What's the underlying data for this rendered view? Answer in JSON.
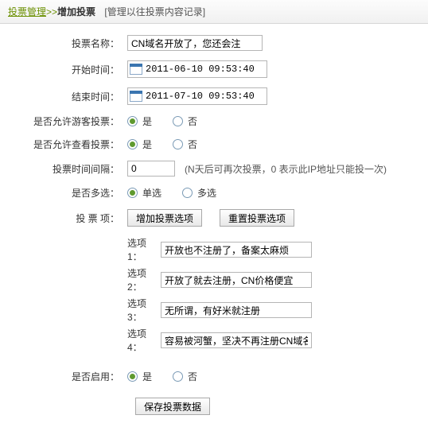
{
  "breadcrumb": {
    "root": "投票管理",
    "sep": ">>",
    "current": "增加投票",
    "note": "[管理以往投票内容记录]"
  },
  "labels": {
    "name": "投票名称：",
    "start": "开始时间：",
    "end": "结束时间：",
    "guest": "是否允许游客投票：",
    "view": "是否允许查看投票：",
    "interval": "投票时间间隔：",
    "multi": "是否多选：",
    "options": "投 票 项：",
    "enable": "是否启用："
  },
  "values": {
    "name": "CN域名开放了，您还会注",
    "start": "2011-06-10 09:53:40",
    "end": "2011-07-10 09:53:40",
    "interval": "0"
  },
  "radios": {
    "yes": "是",
    "no": "否",
    "single": "单选",
    "multi": "多选"
  },
  "interval_hint": "(N天后可再次投票，0 表示此IP地址只能投一次)",
  "buttons": {
    "add_option": "增加投票选项",
    "reset_option": "重置投票选项",
    "submit": "保存投票数据"
  },
  "options": [
    {
      "label": "选项1：",
      "value": "开放也不注册了，备案太麻烦"
    },
    {
      "label": "选项2：",
      "value": "开放了就去注册，CN价格便宜"
    },
    {
      "label": "选项3：",
      "value": "无所谓，有好米就注册"
    },
    {
      "label": "选项4：",
      "value": "容易被河蟹，坚决不再注册CN域名"
    }
  ]
}
